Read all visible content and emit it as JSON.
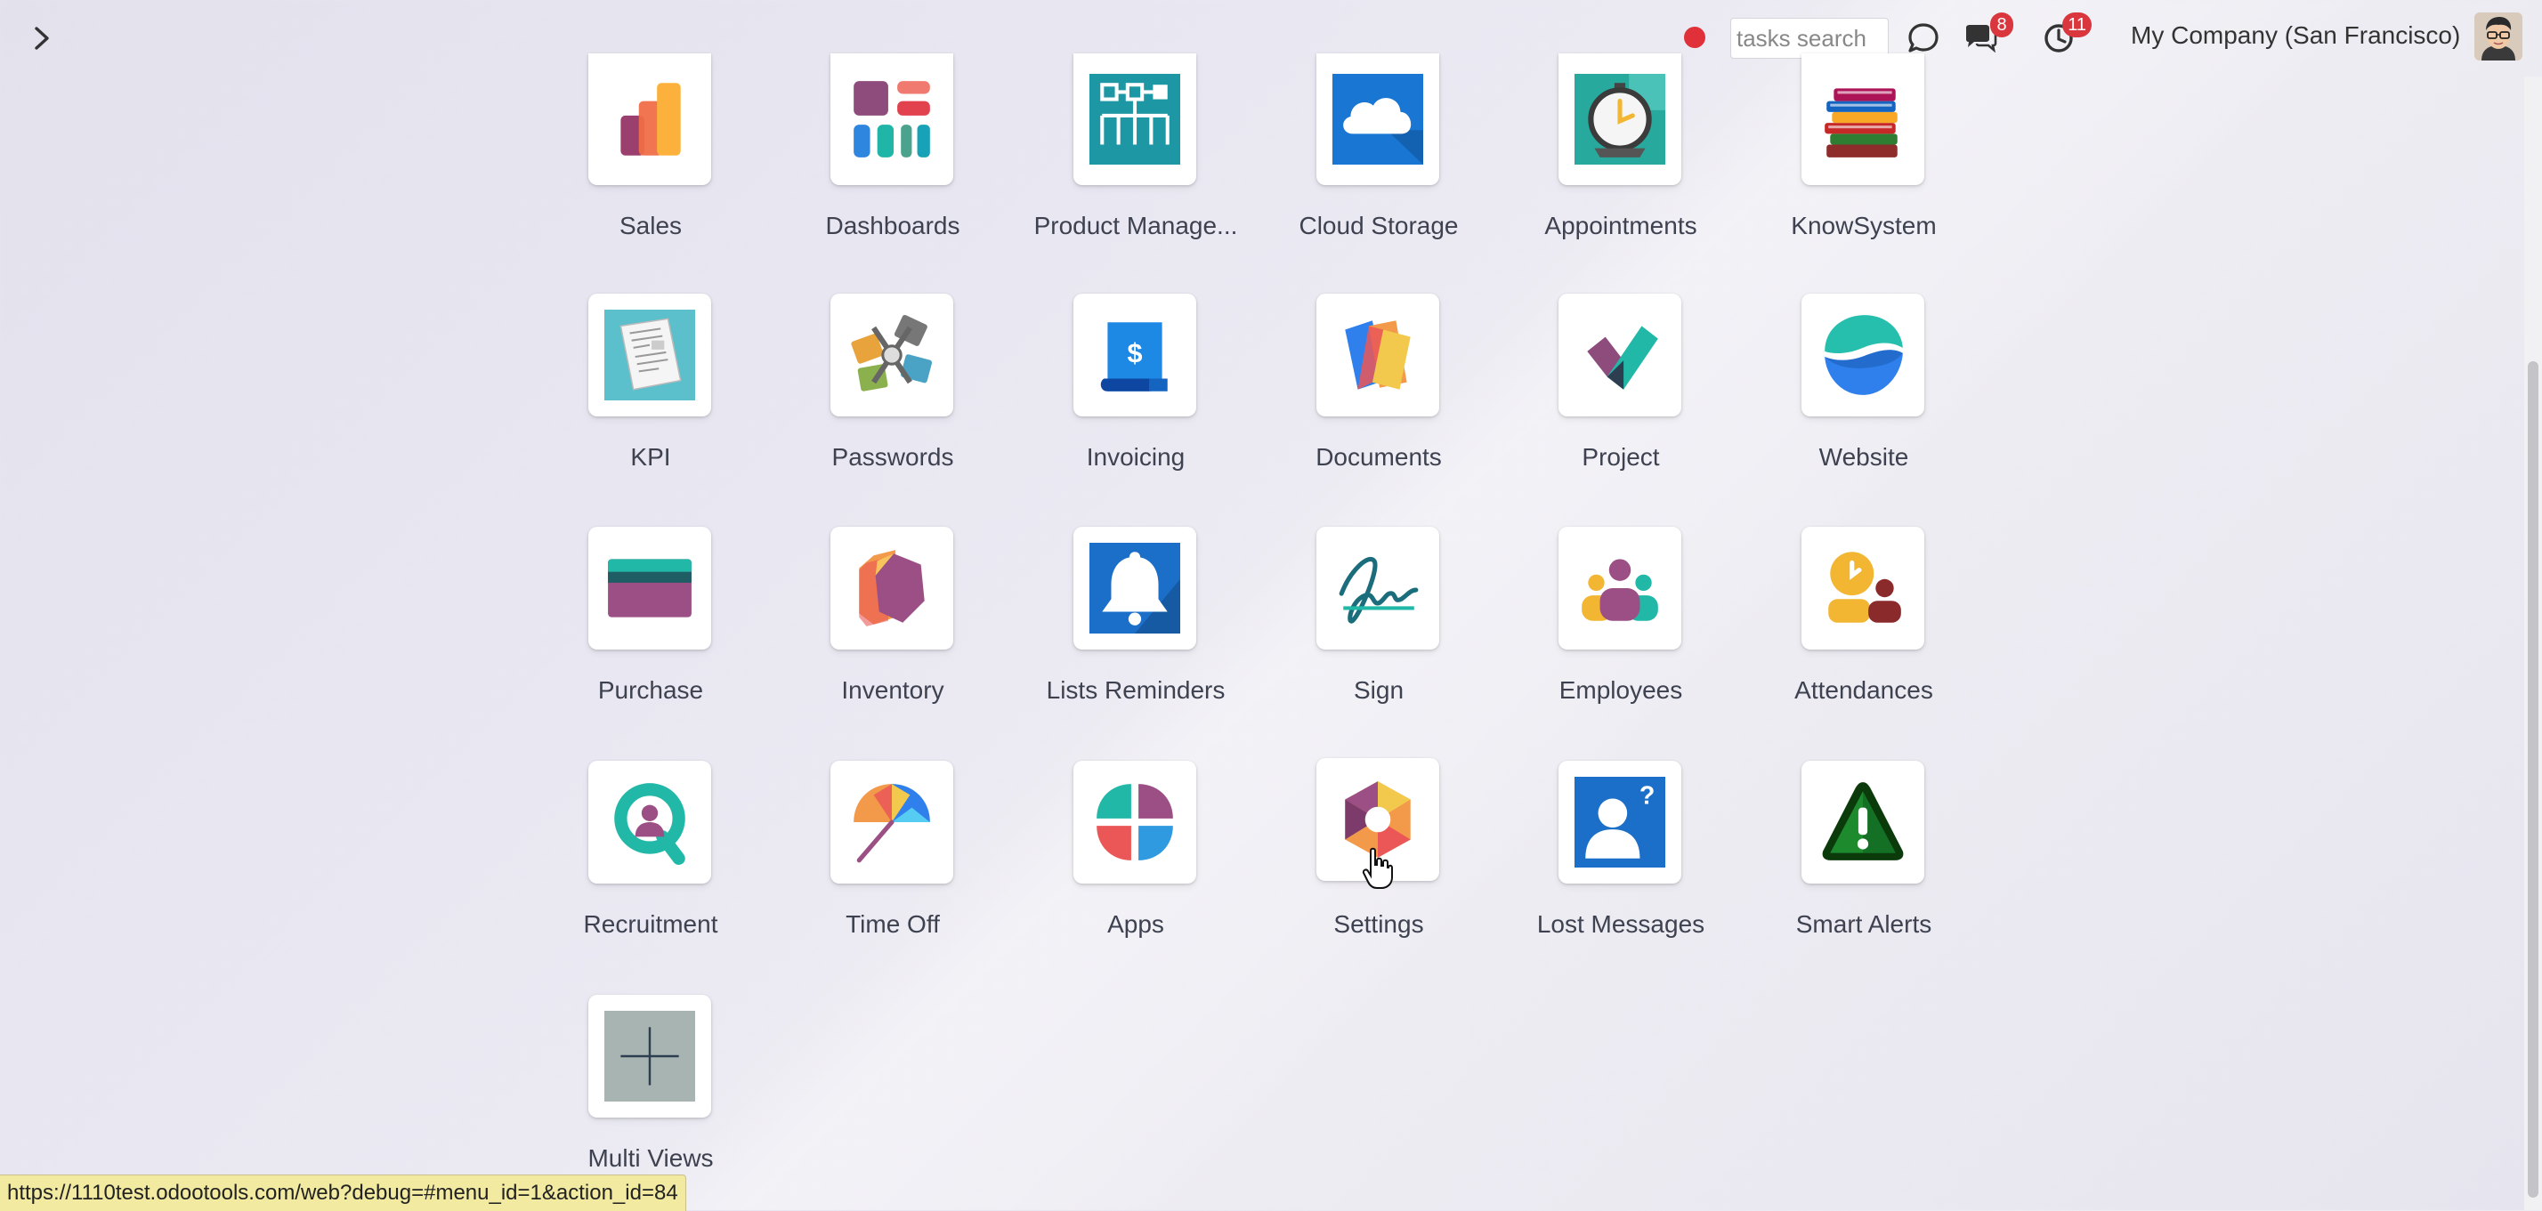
{
  "topbar": {
    "search_placeholder": "tasks search",
    "messages_count": "8",
    "activities_count": "11",
    "company": "My Company (San Francisco)"
  },
  "apps": [
    {
      "label": "Sales",
      "icon": "sales-icon"
    },
    {
      "label": "Dashboards",
      "icon": "dashboards-icon"
    },
    {
      "label": "Product Manage...",
      "icon": "product-management-icon"
    },
    {
      "label": "Cloud Storage",
      "icon": "cloud-storage-icon"
    },
    {
      "label": "Appointments",
      "icon": "appointments-icon"
    },
    {
      "label": "KnowSystem",
      "icon": "knowsystem-icon"
    },
    {
      "label": "KPI",
      "icon": "kpi-icon"
    },
    {
      "label": "Passwords",
      "icon": "passwords-icon"
    },
    {
      "label": "Invoicing",
      "icon": "invoicing-icon"
    },
    {
      "label": "Documents",
      "icon": "documents-icon"
    },
    {
      "label": "Project",
      "icon": "project-icon"
    },
    {
      "label": "Website",
      "icon": "website-icon"
    },
    {
      "label": "Purchase",
      "icon": "purchase-icon"
    },
    {
      "label": "Inventory",
      "icon": "inventory-icon"
    },
    {
      "label": "Lists Reminders",
      "icon": "lists-reminders-icon"
    },
    {
      "label": "Sign",
      "icon": "sign-icon"
    },
    {
      "label": "Employees",
      "icon": "employees-icon"
    },
    {
      "label": "Attendances",
      "icon": "attendances-icon"
    },
    {
      "label": "Recruitment",
      "icon": "recruitment-icon"
    },
    {
      "label": "Time Off",
      "icon": "time-off-icon"
    },
    {
      "label": "Apps",
      "icon": "apps-icon"
    },
    {
      "label": "Settings",
      "icon": "settings-icon"
    },
    {
      "label": "Lost Messages",
      "icon": "lost-messages-icon"
    },
    {
      "label": "Smart Alerts",
      "icon": "smart-alerts-icon"
    },
    {
      "label": "Multi Views",
      "icon": "multi-views-icon"
    }
  ],
  "status_bar": {
    "url": "https://1110test.odootools.com/web?debug=#menu_id=1&action_id=84"
  },
  "colors": {
    "badge": "#d9363e",
    "record_dot": "#e0313a"
  }
}
